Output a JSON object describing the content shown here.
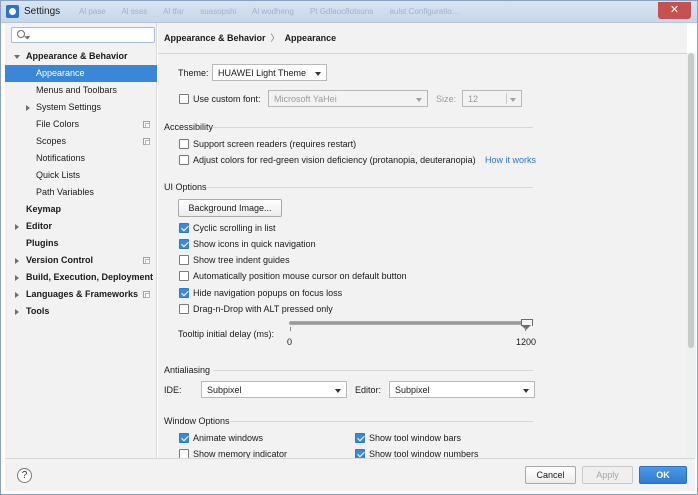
{
  "window": {
    "title": "Settings",
    "background_tabs": [
      "Al pase",
      "Al ssas",
      "Al tfar",
      "suasopshi",
      "Al wodheng",
      "Pt Gdlaoc8otsuns",
      "aulst Configuratio..."
    ],
    "close_glyph": "✕"
  },
  "search": {
    "placeholder": ""
  },
  "sidebar": {
    "items": [
      {
        "label": "Appearance & Behavior",
        "bold": true,
        "arrow": "down"
      },
      {
        "label": "Appearance",
        "selected": true
      },
      {
        "label": "Menus and Toolbars"
      },
      {
        "label": "System Settings",
        "arrow": "right"
      },
      {
        "label": "File Colors",
        "project_icon": true
      },
      {
        "label": "Scopes",
        "project_icon": true
      },
      {
        "label": "Notifications"
      },
      {
        "label": "Quick Lists"
      },
      {
        "label": "Path Variables"
      },
      {
        "label": "Keymap",
        "bold": true
      },
      {
        "label": "Editor",
        "bold": true,
        "arrow": "right"
      },
      {
        "label": "Plugins",
        "bold": true
      },
      {
        "label": "Version Control",
        "bold": true,
        "arrow": "right",
        "project_icon": true
      },
      {
        "label": "Build, Execution, Deployment",
        "bold": true,
        "arrow": "right"
      },
      {
        "label": "Languages & Frameworks",
        "bold": true,
        "arrow": "right",
        "project_icon": true
      },
      {
        "label": "Tools",
        "bold": true,
        "arrow": "right"
      }
    ]
  },
  "breadcrumb": {
    "parent": "Appearance & Behavior",
    "separator": "〉",
    "current": "Appearance"
  },
  "theme": {
    "label": "Theme:",
    "value": "HUAWEI Light Theme"
  },
  "custom_font": {
    "label": "Use custom font:",
    "checked": false,
    "font_value": "Microsoft YaHei",
    "size_label": "Size:",
    "size_value": "12"
  },
  "accessibility": {
    "title": "Accessibility",
    "screen_readers": {
      "label": "Support screen readers (requires restart)",
      "checked": false
    },
    "color_deficiency": {
      "label": "Adjust colors for red-green vision deficiency (protanopia, deuteranopia)",
      "checked": false
    },
    "how_it_works": "How it works"
  },
  "ui_options": {
    "title": "UI Options",
    "background_image_button": "Background Image...",
    "options": [
      {
        "label": "Cyclic scrolling in list",
        "checked": true
      },
      {
        "label": "Show icons in quick navigation",
        "checked": true
      },
      {
        "label": "Show tree indent guides",
        "checked": false
      },
      {
        "label": "Automatically position mouse cursor on default button",
        "checked": false
      },
      {
        "label": "Hide navigation popups on focus loss",
        "checked": true
      },
      {
        "label": "Drag-n-Drop with ALT pressed only",
        "checked": false
      }
    ],
    "tooltip_delay": {
      "label": "Tooltip initial delay (ms):",
      "min": "0",
      "max": "1200",
      "value_fraction": 1.0
    }
  },
  "antialiasing": {
    "title": "Antialiasing",
    "ide_label": "IDE:",
    "ide_value": "Subpixel",
    "editor_label": "Editor:",
    "editor_value": "Subpixel"
  },
  "window_options": {
    "title": "Window Options",
    "animate_windows": {
      "label": "Animate windows",
      "checked": true
    },
    "show_memory": {
      "label": "Show memory indicator",
      "checked": false
    },
    "show_tool_bars": {
      "label": "Show tool window bars",
      "checked": true
    },
    "show_tool_numbers": {
      "label": "Show tool window numbers",
      "checked": true
    }
  },
  "footer": {
    "help": "?",
    "cancel": "Cancel",
    "apply": "Apply",
    "ok": "OK"
  },
  "colors": {
    "accent": "#3a87d6",
    "link": "#2f73c6",
    "checkbox_checked": "#3c8ade",
    "close_button": "#c75050"
  }
}
